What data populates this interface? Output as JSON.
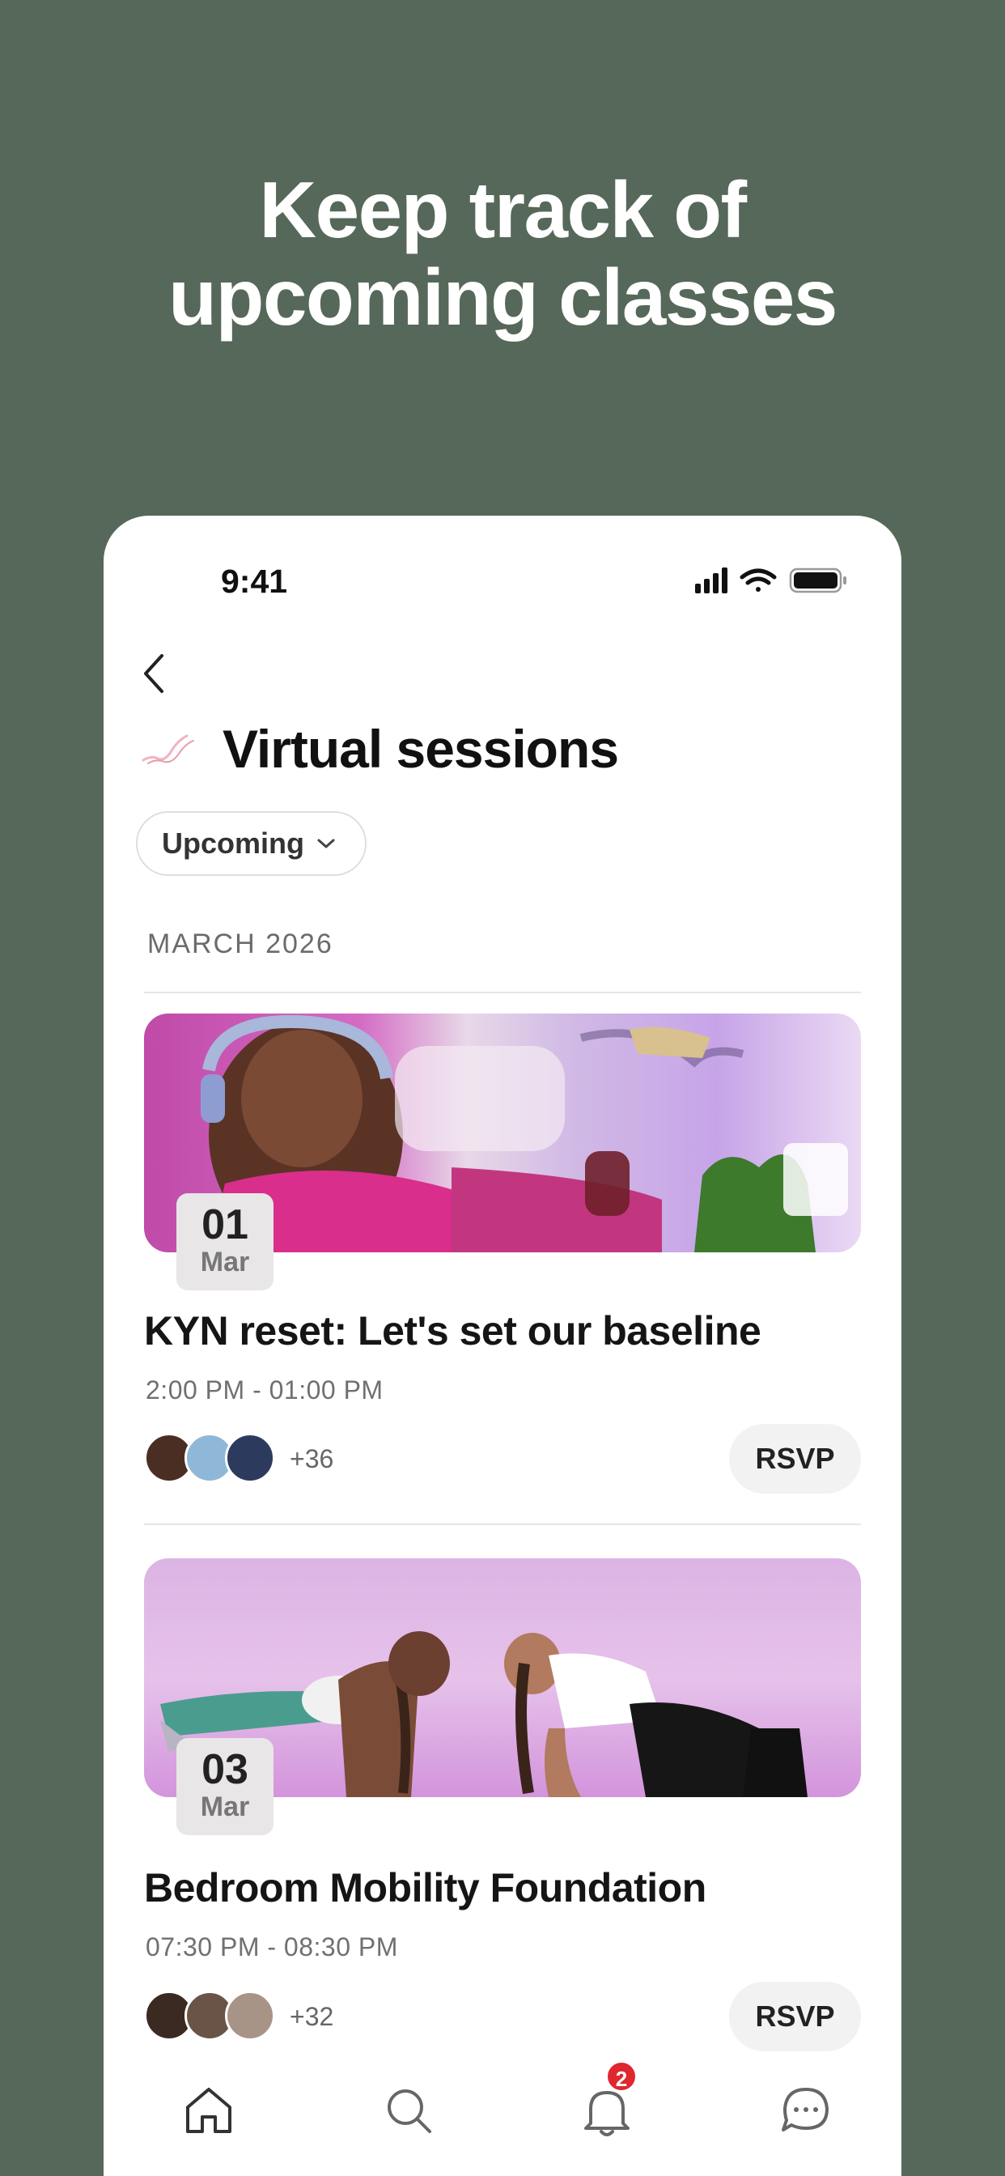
{
  "promo": {
    "headline_line1": "Keep track of",
    "headline_line2": "upcoming classes"
  },
  "status_bar": {
    "time": "9:41",
    "icons": [
      "signal-icon",
      "wifi-icon",
      "battery-icon"
    ]
  },
  "header": {
    "back_icon": "chevron-left-icon",
    "logo_icon": "brand-logo",
    "title": "Virtual sessions"
  },
  "filter": {
    "label": "Upcoming",
    "icon": "chevron-down-icon"
  },
  "section": {
    "month_label": "MARCH 2026"
  },
  "events": [
    {
      "day": "01",
      "month": "Mar",
      "title": "KYN reset: Let's set our baseline",
      "time": "2:00 PM - 01:00 PM",
      "attendees_more": "+36",
      "rsvp_label": "RSVP"
    },
    {
      "day": "03",
      "month": "Mar",
      "title": "Bedroom Mobility Foundation",
      "time": "07:30 PM - 08:30 PM",
      "attendees_more": "+32",
      "rsvp_label": "RSVP"
    }
  ],
  "tab_bar": {
    "tabs": [
      "home-icon",
      "search-icon",
      "bell-icon",
      "chat-icon"
    ],
    "notification_count": "2"
  },
  "colors": {
    "background": "#566859",
    "badge": "#e0262f",
    "rsvp_bg": "#f2f2f2"
  }
}
